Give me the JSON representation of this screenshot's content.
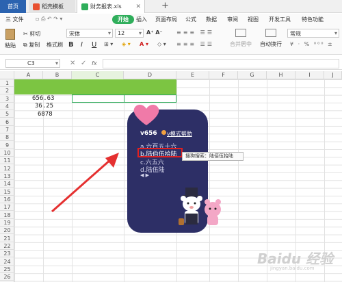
{
  "tabs": {
    "home": "首页",
    "template": "稻壳模板",
    "file": "财务报表.xls",
    "new": "+"
  },
  "menu": {
    "file": "三 文件",
    "start": "开始",
    "items": [
      "插入",
      "页面布局",
      "公式",
      "数据",
      "审阅",
      "视图",
      "开发工具",
      "特色功能"
    ]
  },
  "toolbar": {
    "paste": "粘贴",
    "cut": "剪切",
    "copy": "复制",
    "format_painter": "格式刷",
    "font": "宋体",
    "font_size": "12",
    "merge_center": "合并居中",
    "wrap": "自动换行",
    "number_format": "常规",
    "bold": "B",
    "italic": "I",
    "underline": "U"
  },
  "formula_bar": {
    "cell_ref": "C3",
    "fx": "fx"
  },
  "columns": [
    "A",
    "B",
    "C",
    "D",
    "E",
    "F",
    "G",
    "H",
    "I",
    "J"
  ],
  "rows": [
    "1",
    "2",
    "3",
    "4",
    "5",
    "6",
    "7",
    "8",
    "9",
    "10",
    "11",
    "12",
    "13",
    "14",
    "15",
    "16",
    "17",
    "18",
    "19",
    "20",
    "21",
    "22",
    "23",
    "24",
    "25",
    "26"
  ],
  "cells": {
    "a3": "656.63",
    "a4": "36.25",
    "a5": "6878"
  },
  "ime_popup": {
    "title": "v656",
    "help": "v模式帮助",
    "options": [
      "a.六百五十六",
      "b.陆伯伍拾陆",
      "c.六五六",
      "d.陆伍陆"
    ],
    "nav": "◀ ▶",
    "tooltip": "搜狗搜索：陆佰伍拾陆"
  },
  "colors": {
    "accent_green": "#2fae5b",
    "header_green": "#7cc542",
    "popup_bg": "#2d2f66",
    "highlight_red": "#e02020"
  },
  "watermark": {
    "main": "Baidu 经验",
    "sub": "jingyan.baidu.com"
  }
}
